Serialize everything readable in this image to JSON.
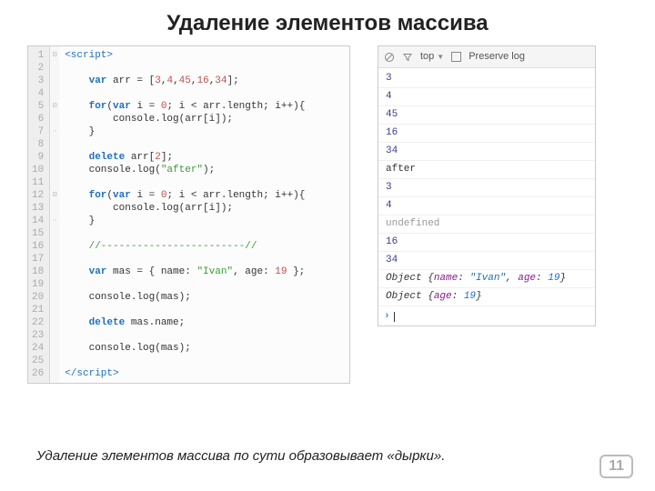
{
  "title": "Удаление элементов массива",
  "caption": "Удаление элементов массива по сути образовывает «дырки».",
  "page_number": "11",
  "code": {
    "line_count": 26,
    "fold_markers": {
      "1": "⊟",
      "5": "⊟",
      "7": "·",
      "12": "⊟",
      "14": "·"
    },
    "lines": [
      {
        "n": 1,
        "html": "<span class='t-tag'>&lt;script&gt;</span>"
      },
      {
        "n": 2,
        "html": ""
      },
      {
        "n": 3,
        "html": "    <span class='t-kw'>var</span><span class='t-pln'> arr = [</span><span class='t-num'>3</span><span class='t-pln'>,</span><span class='t-num'>4</span><span class='t-pln'>,</span><span class='t-num'>45</span><span class='t-pln'>,</span><span class='t-num'>16</span><span class='t-pln'>,</span><span class='t-num'>34</span><span class='t-pln'>];</span>"
      },
      {
        "n": 4,
        "html": ""
      },
      {
        "n": 5,
        "html": "    <span class='t-kw'>for</span><span class='t-pln'>(</span><span class='t-kw'>var</span><span class='t-pln'> i = </span><span class='t-num'>0</span><span class='t-pln'>; i &lt; arr.length; i++){</span>"
      },
      {
        "n": 6,
        "html": "        <span class='t-pln'>console.log(arr[i]);</span>"
      },
      {
        "n": 7,
        "html": "    <span class='t-pln'>}</span>"
      },
      {
        "n": 8,
        "html": ""
      },
      {
        "n": 9,
        "html": "    <span class='t-kw'>delete</span><span class='t-pln'> arr[</span><span class='t-num'>2</span><span class='t-pln'>];</span>"
      },
      {
        "n": 10,
        "html": "    <span class='t-pln'>console.log(</span><span class='t-str'>\"after\"</span><span class='t-pln'>);</span>"
      },
      {
        "n": 11,
        "html": ""
      },
      {
        "n": 12,
        "html": "    <span class='t-kw'>for</span><span class='t-pln'>(</span><span class='t-kw'>var</span><span class='t-pln'> i = </span><span class='t-num'>0</span><span class='t-pln'>; i &lt; arr.length; i++){</span>"
      },
      {
        "n": 13,
        "html": "        <span class='t-pln'>console.log(arr[i]);</span>"
      },
      {
        "n": 14,
        "html": "    <span class='t-pln'>}</span>"
      },
      {
        "n": 15,
        "html": ""
      },
      {
        "n": 16,
        "html": "    <span class='t-cmt'>//------------------------//</span>"
      },
      {
        "n": 17,
        "html": ""
      },
      {
        "n": 18,
        "html": "    <span class='t-kw'>var</span><span class='t-pln'> mas = { name: </span><span class='t-str'>\"Ivan\"</span><span class='t-pln'>, age: </span><span class='t-num'>19</span><span class='t-pln'> };</span>"
      },
      {
        "n": 19,
        "html": ""
      },
      {
        "n": 20,
        "html": "    <span class='t-pln'>console.log(mas);</span>"
      },
      {
        "n": 21,
        "html": ""
      },
      {
        "n": 22,
        "html": "    <span class='t-kw'>delete</span><span class='t-pln'> mas.name;</span>"
      },
      {
        "n": 23,
        "html": ""
      },
      {
        "n": 24,
        "html": "    <span class='t-pln'>console.log(mas);</span>"
      },
      {
        "n": 25,
        "html": ""
      },
      {
        "n": 26,
        "html": "<span class='t-tag'>&lt;/script&gt;</span>"
      }
    ]
  },
  "console": {
    "toolbar": {
      "frame_selector": "top",
      "preserve_label": "Preserve log"
    },
    "lines": [
      {
        "cls": "",
        "html": "3"
      },
      {
        "cls": "",
        "html": "4"
      },
      {
        "cls": "",
        "html": "45"
      },
      {
        "cls": "",
        "html": "16"
      },
      {
        "cls": "",
        "html": "34"
      },
      {
        "cls": "str",
        "html": "after"
      },
      {
        "cls": "",
        "html": "3"
      },
      {
        "cls": "",
        "html": "4"
      },
      {
        "cls": "undef",
        "html": "undefined"
      },
      {
        "cls": "",
        "html": "16"
      },
      {
        "cls": "",
        "html": "34"
      },
      {
        "cls": "obj",
        "html": "Object {<span class='k'>name</span>: <span class='v'>\"Ivan\"</span>, <span class='k'>age</span>: <span class='n'>19</span>}"
      },
      {
        "cls": "obj",
        "html": "Object {<span class='k'>age</span>: <span class='n'>19</span>}"
      }
    ]
  }
}
